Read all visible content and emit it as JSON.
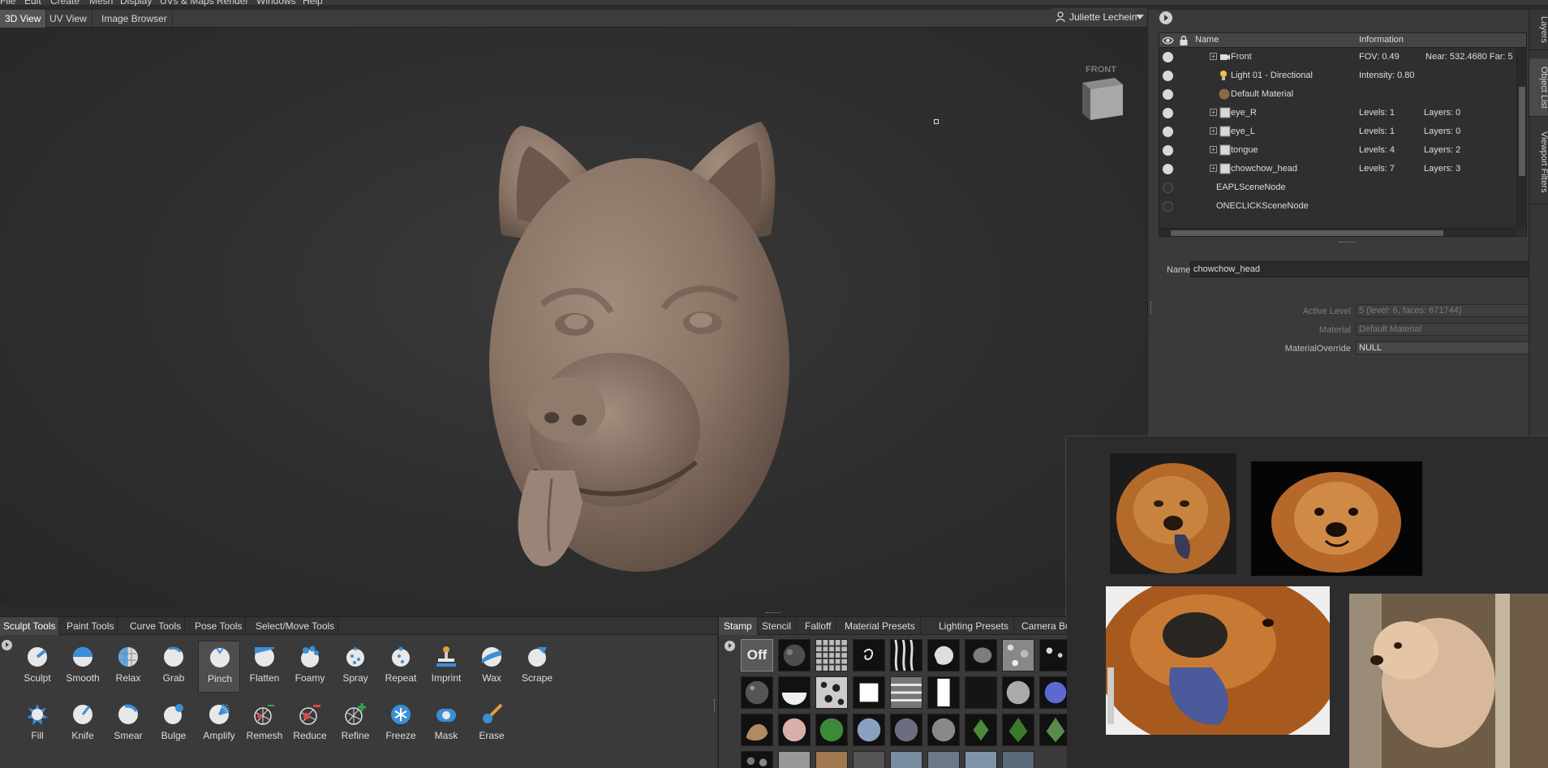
{
  "menubar": {
    "items": [
      "File",
      "Edit",
      "Create",
      "Mesh",
      "Display",
      "UVs & Maps",
      "Render",
      "Windows",
      "Help"
    ]
  },
  "viewport_tabs": [
    "3D View",
    "UV View",
    "Image Browser"
  ],
  "user": {
    "name": "Juliette Lechein"
  },
  "viewcube": {
    "label": "FRONT"
  },
  "outliner": {
    "columns": {
      "name": "Name",
      "info": "Information"
    },
    "rows": [
      {
        "name": "Front",
        "info1": "FOV: 0.49",
        "info2": "Near: 532.4680 Far: 5",
        "icon": "camera-icon",
        "expandable": true,
        "visible": true
      },
      {
        "name": "Light 01 - Directional",
        "info1": "Intensity: 0.80",
        "info2": "",
        "icon": "light-bulb-icon",
        "expandable": false,
        "visible": true
      },
      {
        "name": "Default Material",
        "info1": "",
        "info2": "",
        "icon": "material-sphere-icon",
        "expandable": false,
        "visible": true
      },
      {
        "name": "eye_R",
        "info1": "Levels: 1",
        "info2": "Layers: 0",
        "icon": "mesh-cube-icon",
        "expandable": true,
        "visible": true
      },
      {
        "name": "eye_L",
        "info1": "Levels: 1",
        "info2": "Layers: 0",
        "icon": "mesh-cube-icon",
        "expandable": true,
        "visible": true
      },
      {
        "name": "tongue",
        "info1": "Levels: 4",
        "info2": "Layers: 2",
        "icon": "mesh-cube-icon",
        "expandable": true,
        "visible": true
      },
      {
        "name": "chowchow_head",
        "info1": "Levels: 7",
        "info2": "Layers: 3",
        "icon": "mesh-cube-icon",
        "expandable": true,
        "visible": true
      },
      {
        "name": "EAPLSceneNode",
        "info1": "",
        "info2": "",
        "icon": "",
        "expandable": false,
        "visible": false
      },
      {
        "name": "ONECLICKSceneNode",
        "info1": "",
        "info2": "",
        "icon": "",
        "expandable": false,
        "visible": false
      }
    ]
  },
  "properties": {
    "name_label": "Name",
    "name_value": "chowchow_head",
    "active_level_label": "Active Level",
    "active_level_value": "5 (level: 6, faces: 671744)",
    "material_label": "Material",
    "material_value": "Default Material",
    "material_override_label": "MaterialOverride",
    "material_override_value": "NULL"
  },
  "side_tabs": [
    "Layers",
    "Object List",
    "Viewport Filters"
  ],
  "tool_tabs": [
    "Sculpt Tools",
    "Paint Tools",
    "Curve Tools",
    "Pose Tools",
    "Select/Move Tools"
  ],
  "tools": [
    {
      "label": "Sculpt",
      "icon": "sculpt-icon"
    },
    {
      "label": "Smooth",
      "icon": "smooth-icon"
    },
    {
      "label": "Relax",
      "icon": "relax-icon"
    },
    {
      "label": "Grab",
      "icon": "grab-icon"
    },
    {
      "label": "Pinch",
      "icon": "pinch-icon"
    },
    {
      "label": "Flatten",
      "icon": "flatten-icon"
    },
    {
      "label": "Foamy",
      "icon": "foamy-icon"
    },
    {
      "label": "Spray",
      "icon": "spray-icon"
    },
    {
      "label": "Repeat",
      "icon": "repeat-icon"
    },
    {
      "label": "Imprint",
      "icon": "imprint-icon"
    },
    {
      "label": "Wax",
      "icon": "wax-icon"
    },
    {
      "label": "Scrape",
      "icon": "scrape-icon"
    },
    {
      "label": "Fill",
      "icon": "fill-icon"
    },
    {
      "label": "Knife",
      "icon": "knife-icon"
    },
    {
      "label": "Smear",
      "icon": "smear-icon"
    },
    {
      "label": "Bulge",
      "icon": "bulge-icon"
    },
    {
      "label": "Amplify",
      "icon": "amplify-icon"
    },
    {
      "label": "Remesh",
      "icon": "remesh-icon"
    },
    {
      "label": "Reduce",
      "icon": "reduce-icon"
    },
    {
      "label": "Refine",
      "icon": "refine-icon"
    },
    {
      "label": "Freeze",
      "icon": "freeze-icon"
    },
    {
      "label": "Mask",
      "icon": "mask-icon"
    },
    {
      "label": "Erase",
      "icon": "erase-icon"
    }
  ],
  "active_tool": "Pinch",
  "stamp_tabs": [
    "Stamp",
    "Stencil",
    "Falloff",
    "Material Presets",
    "Lighting Presets",
    "Camera Boo"
  ],
  "stamp_off_label": "Off",
  "colors": {
    "accent_blue": "#3a8fd8",
    "clay": "#8b776a",
    "panel": "#3a3a3a"
  }
}
